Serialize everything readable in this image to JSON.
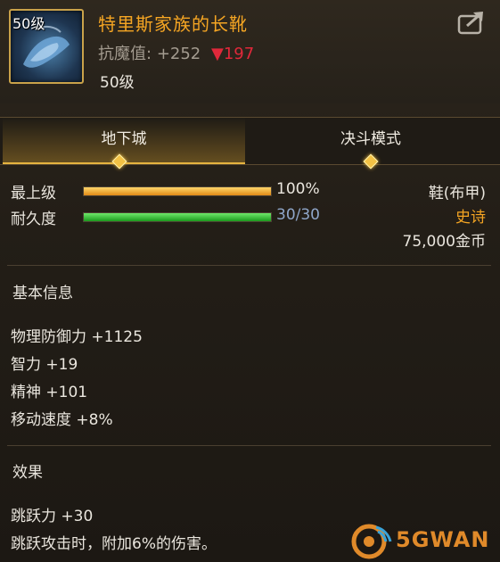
{
  "item": {
    "level_badge": "50级",
    "name": "特里斯家族的长靴",
    "magic_resist_label": "抗魔值:",
    "magic_resist_value": "+252",
    "magic_resist_diff": "▼197",
    "required_level": "50级",
    "share_icon": "share-icon"
  },
  "tabs": [
    {
      "label": "地下城",
      "active": true
    },
    {
      "label": "决斗模式",
      "active": false
    }
  ],
  "stats": {
    "max_level": {
      "label": "最上级",
      "value_text": "100%",
      "fill_fraction": 1.0
    },
    "durability": {
      "label": "耐久度",
      "value_text": "30/30",
      "fill_fraction": 1.0
    }
  },
  "meta": {
    "slot": "鞋(布甲)",
    "rarity": "史诗",
    "price": "75,000金币"
  },
  "basic_info": {
    "title": "基本信息",
    "attributes": [
      "物理防御力 +1125",
      "智力 +19",
      "精神 +101",
      "移动速度 +8%"
    ]
  },
  "effects": {
    "title": "效果",
    "lines": [
      "跳跃力 +30",
      "跳跃攻击时，附加6%的伤害。"
    ]
  },
  "watermark": {
    "text": "5GWAN"
  },
  "colors": {
    "name": "#f5a523",
    "rarity": "#f5a523",
    "diff": "#e0283a",
    "accent": "#e6b440"
  }
}
